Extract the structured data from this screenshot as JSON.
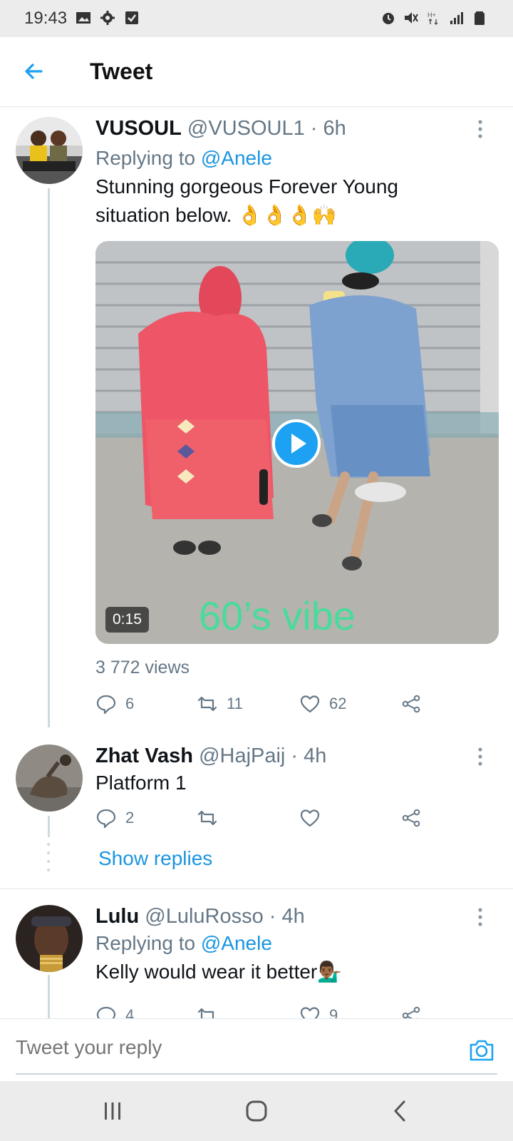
{
  "status_bar": {
    "time": "19:43",
    "left_icons": [
      "image-icon",
      "gear-icon",
      "checkbox-icon"
    ],
    "right_icons": [
      "alarm-icon",
      "mute-icon",
      "network-hplus-icon",
      "signal-icon",
      "battery-icon"
    ]
  },
  "header": {
    "title": "Tweet",
    "back_icon": "arrow-left-icon",
    "accent": "#1da1f2"
  },
  "tweets": [
    {
      "display_name": "VUSOUL",
      "handle": "@VUSOUL1",
      "time": " · 6h",
      "replying_prefix": "Replying to ",
      "replying_to": "@Anele",
      "text_line1": "Stunning gorgeous Forever Young",
      "text_line2": "situation below. 👌👌👌🙌",
      "media": {
        "duration": "0:15",
        "caption": "60’s vibe"
      },
      "views": "3 772 views",
      "replies": "6",
      "retweets": "11",
      "likes": "62"
    },
    {
      "display_name": "Zhat Vash",
      "handle": "@HajPaij",
      "time": " · 4h",
      "text": "Platform 1",
      "replies": "2",
      "retweets": "",
      "likes": "",
      "show_replies": "Show replies"
    },
    {
      "display_name": "Lulu",
      "handle": "@LuluRosso",
      "time": " · 4h",
      "replying_prefix": "Replying to ",
      "replying_to": "@Anele",
      "text": "Kelly would wear it better💁🏾‍♂️",
      "replies": "4",
      "retweets": "",
      "likes": "9"
    }
  ],
  "composer": {
    "placeholder": "Tweet your reply",
    "camera_icon": "camera-icon"
  },
  "nav_bar": {
    "icons": [
      "recents-icon",
      "home-icon",
      "back-icon"
    ]
  },
  "colors": {
    "link": "#1b95e0",
    "secondary_text": "#657786",
    "video_caption": "#3ee09a"
  }
}
